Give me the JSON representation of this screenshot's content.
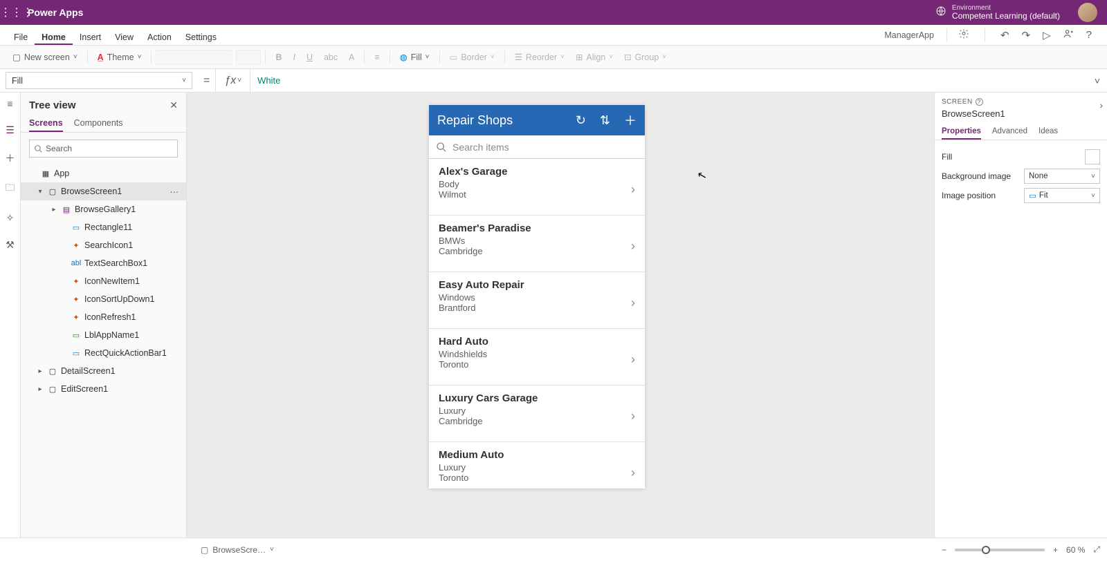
{
  "header": {
    "app_title": "Power Apps",
    "env_label": "Environment",
    "env_name": "Competent Learning (default)"
  },
  "menu": {
    "items": [
      "File",
      "Home",
      "Insert",
      "View",
      "Action",
      "Settings"
    ],
    "active_index": 1,
    "doc_name": "ManagerApp"
  },
  "ribbon": {
    "new_screen": "New screen",
    "theme": "Theme",
    "fill": "Fill",
    "border": "Border",
    "reorder": "Reorder",
    "align": "Align",
    "group": "Group"
  },
  "formula": {
    "property": "Fill",
    "value": "White"
  },
  "tree": {
    "title": "Tree view",
    "tabs": [
      "Screens",
      "Components"
    ],
    "active_tab": 0,
    "search_placeholder": "Search",
    "items": [
      {
        "label": "App",
        "depth": 0,
        "icon": "▦",
        "twist": ""
      },
      {
        "label": "BrowseScreen1",
        "depth": 1,
        "icon": "▢",
        "twist": "▾",
        "selected": true,
        "more": true
      },
      {
        "label": "BrowseGallery1",
        "depth": 2,
        "icon": "▤",
        "icoClass": "ico-purple",
        "twist": "▸"
      },
      {
        "label": "Rectangle11",
        "depth": 3,
        "icon": "▭",
        "icoClass": "ico-blue"
      },
      {
        "label": "SearchIcon1",
        "depth": 3,
        "icon": "✦",
        "icoClass": "ico-orange"
      },
      {
        "label": "TextSearchBox1",
        "depth": 3,
        "icon": "abl",
        "icoClass": "ico-blue"
      },
      {
        "label": "IconNewItem1",
        "depth": 3,
        "icon": "✦",
        "icoClass": "ico-orange"
      },
      {
        "label": "IconSortUpDown1",
        "depth": 3,
        "icon": "✦",
        "icoClass": "ico-orange"
      },
      {
        "label": "IconRefresh1",
        "depth": 3,
        "icon": "✦",
        "icoClass": "ico-orange"
      },
      {
        "label": "LblAppName1",
        "depth": 3,
        "icon": "▭",
        "icoClass": "ico-green"
      },
      {
        "label": "RectQuickActionBar1",
        "depth": 3,
        "icon": "▭",
        "icoClass": "ico-blue"
      },
      {
        "label": "DetailScreen1",
        "depth": 1,
        "icon": "▢",
        "twist": "▸"
      },
      {
        "label": "EditScreen1",
        "depth": 1,
        "icon": "▢",
        "twist": "▸"
      }
    ]
  },
  "phone": {
    "title": "Repair Shops",
    "search_placeholder": "Search items",
    "items": [
      {
        "name": "Alex's Garage",
        "spec": "Body",
        "city": "Wilmot"
      },
      {
        "name": "Beamer's Paradise",
        "spec": "BMWs",
        "city": "Cambridge"
      },
      {
        "name": "Easy Auto Repair",
        "spec": "Windows",
        "city": "Brantford"
      },
      {
        "name": "Hard Auto",
        "spec": "Windshields",
        "city": "Toronto"
      },
      {
        "name": "Luxury Cars Garage",
        "spec": "Luxury",
        "city": "Cambridge"
      },
      {
        "name": "Medium Auto",
        "spec": "Luxury",
        "city": "Toronto"
      }
    ]
  },
  "props": {
    "kind": "SCREEN",
    "selected": "BrowseScreen1",
    "tabs": [
      "Properties",
      "Advanced",
      "Ideas"
    ],
    "active_tab": 0,
    "rows": {
      "fill_label": "Fill",
      "bg_label": "Background image",
      "bg_value": "None",
      "pos_label": "Image position",
      "pos_value": "Fit"
    }
  },
  "status": {
    "screen": "BrowseScre…",
    "zoom": "60",
    "zoom_unit": "%"
  }
}
